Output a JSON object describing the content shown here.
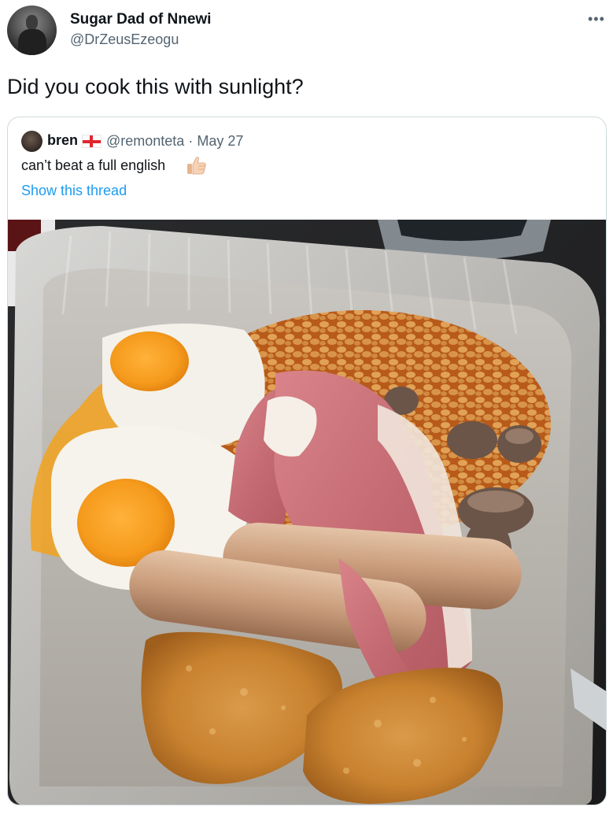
{
  "tweet": {
    "display_name": "Sugar Dad of Nnewi",
    "handle": "@DrZeusEzeogu",
    "text": "Did you cook this with sunlight?",
    "more_icon": "more-horizontal-icon"
  },
  "quoted_tweet": {
    "display_name": "bren",
    "flag_icon": "england-flag-icon",
    "handle": "@remonteta",
    "separator": "·",
    "date": "May 27",
    "text": "can’t beat a full english",
    "emoji_icon": "thumbs-up-icon",
    "show_thread_label": "Show this thread",
    "image_description_icon": "food-photo"
  },
  "colors": {
    "text_primary": "#0f1419",
    "text_secondary": "#536471",
    "link": "#1d9bf0",
    "border": "#cfd9de"
  }
}
